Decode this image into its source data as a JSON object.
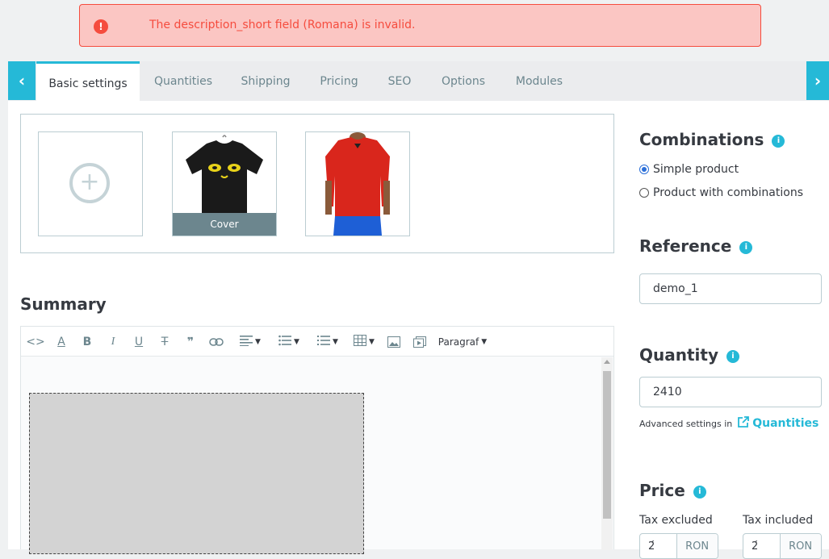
{
  "alert": {
    "message": "The description_short field (Romana) is invalid.",
    "icon": "error-icon",
    "icon_glyph": "!"
  },
  "tabs": {
    "prev_icon": "‹",
    "next_icon": "›",
    "items": [
      {
        "label": "Basic settings",
        "active": true
      },
      {
        "label": "Quantities",
        "active": false
      },
      {
        "label": "Shipping",
        "active": false
      },
      {
        "label": "Pricing",
        "active": false
      },
      {
        "label": "SEO",
        "active": false
      },
      {
        "label": "Options",
        "active": false
      },
      {
        "label": "Modules",
        "active": false
      }
    ]
  },
  "images": {
    "add_glyph": "+",
    "cover_label": "Cover"
  },
  "summary": {
    "title": "Summary",
    "toolbar": {
      "paragraph_label": "Paragraf"
    }
  },
  "combinations": {
    "title": "Combinations",
    "options": [
      {
        "label": "Simple product",
        "checked": true
      },
      {
        "label": "Product with combinations",
        "checked": false
      }
    ]
  },
  "reference": {
    "title": "Reference",
    "value": "demo_1"
  },
  "quantity": {
    "title": "Quantity",
    "value": "2410",
    "advanced_text": "Advanced settings in",
    "advanced_link": "Quantities"
  },
  "price": {
    "title": "Price",
    "tax_excluded_label": "Tax excluded",
    "tax_included_label": "Tax included",
    "tax_excluded_value": "2́",
    "tax_included_value": "2́",
    "currency": "RON"
  },
  "colors": {
    "accent": "#25b9d7",
    "error": "#f54c3e",
    "error_bg": "#fbc6c3"
  }
}
